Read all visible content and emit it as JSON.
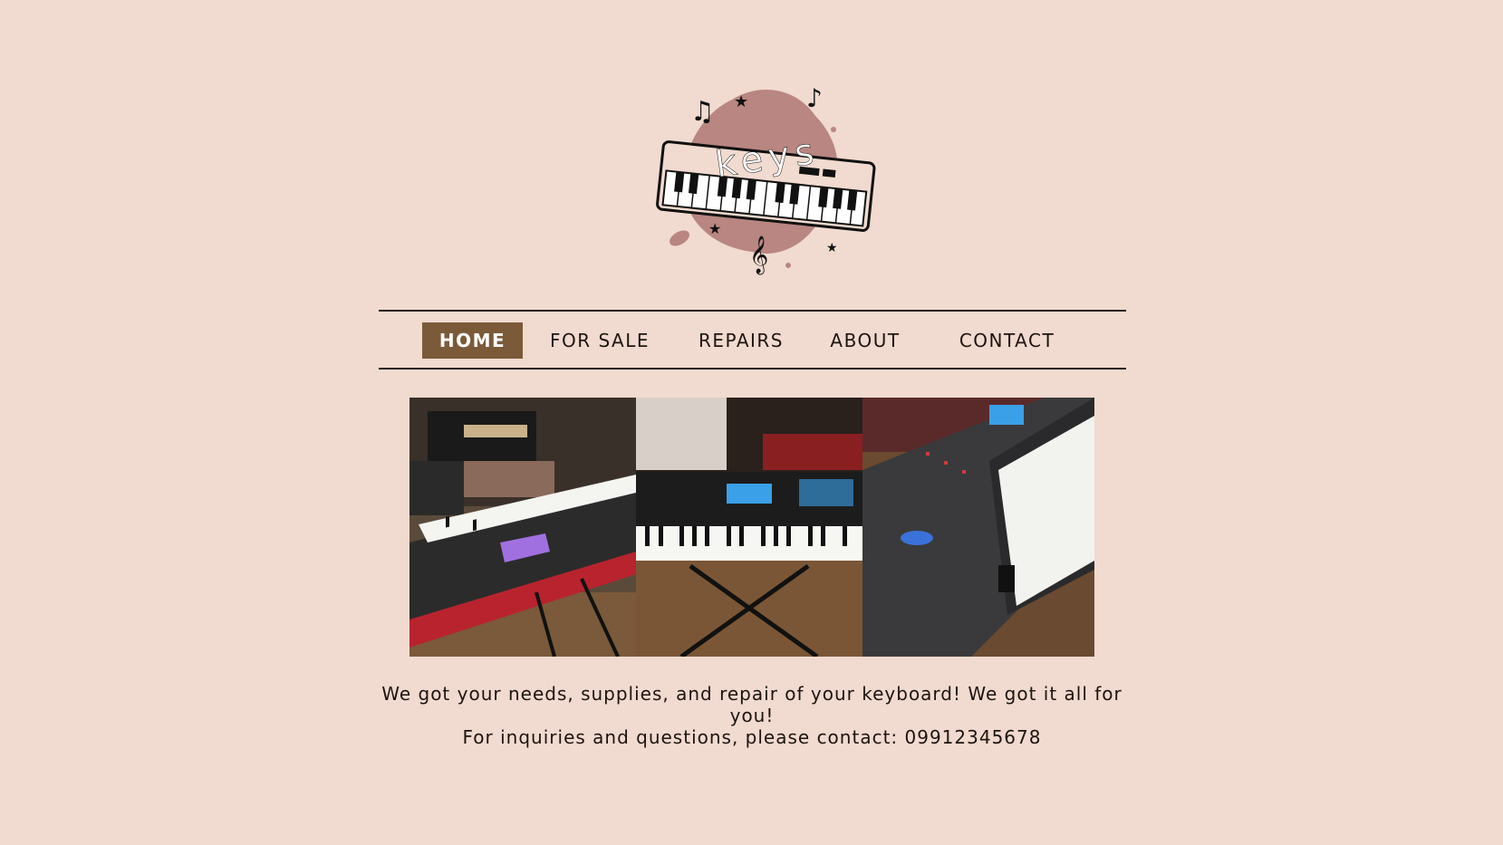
{
  "logo": {
    "text": "keys"
  },
  "nav": {
    "items": [
      {
        "label": "HOME",
        "active": true
      },
      {
        "label": "FOR SALE",
        "active": false
      },
      {
        "label": "REPAIRS",
        "active": false
      },
      {
        "label": "ABOUT",
        "active": false
      },
      {
        "label": "CONTACT",
        "active": false
      }
    ]
  },
  "gallery": {
    "photos": [
      {
        "name": "keyboard-photo-angled"
      },
      {
        "name": "keyboard-photo-front"
      },
      {
        "name": "keyboard-photo-side"
      }
    ]
  },
  "intro": {
    "line1": "We got your needs, supplies, and repair of your keyboard! We got it all for you!",
    "line2": "For inquiries and questions, please contact: 09912345678"
  },
  "colors": {
    "background": "#f1dacf",
    "accent": "#7b5a39",
    "logo_blob": "#b98681"
  }
}
